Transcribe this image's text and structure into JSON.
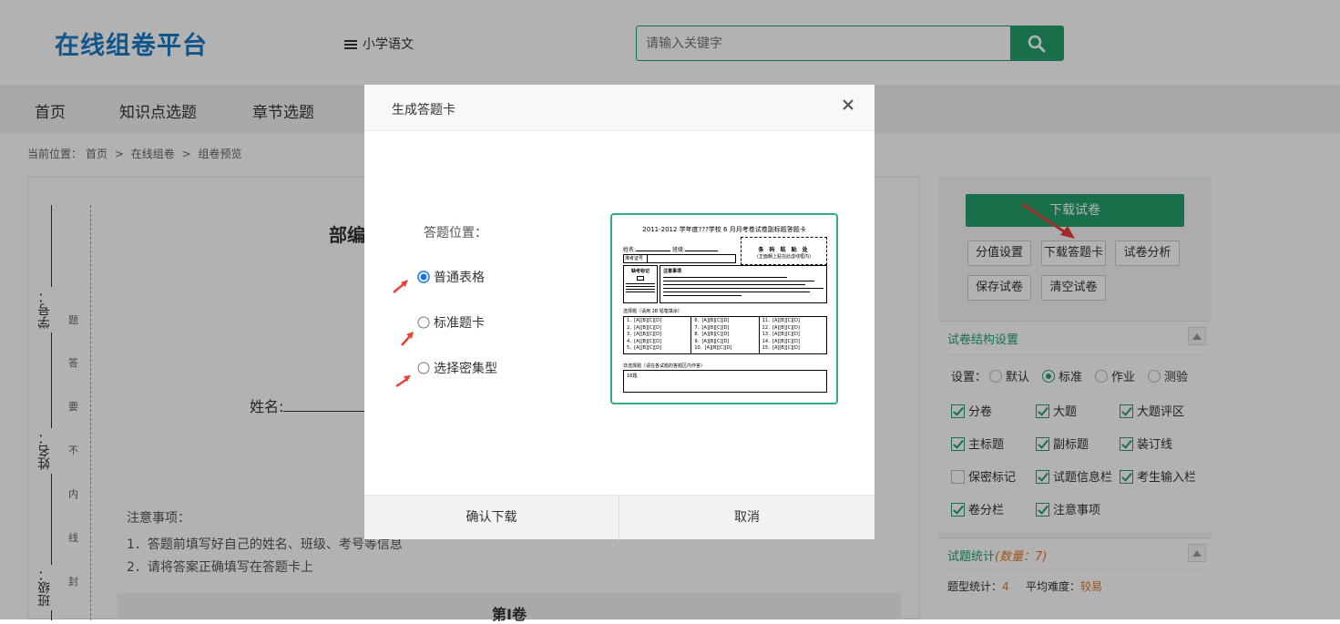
{
  "header": {
    "logo": "在线组卷平台",
    "subject": "小学语文",
    "search_placeholder": "请输入关键字"
  },
  "nav": {
    "items": [
      "首页",
      "知识点选题",
      "章节选题"
    ]
  },
  "breadcrumb": {
    "prefix": "当前位置：",
    "items": [
      "首页",
      "在线组卷",
      "组卷预览"
    ],
    "sep": ">"
  },
  "paper": {
    "title_partial": "部编",
    "name_label": "姓名:",
    "side_labels": [
      "学号：",
      "姓名：",
      "班级："
    ],
    "side_seal": [
      "题",
      "答",
      "要",
      "不",
      "内",
      "线",
      "封"
    ],
    "notice_title": "注意事项：",
    "notice_items": [
      "1．答题前填写好自己的姓名、班级、考号等信息",
      "2．请将答案正确填写在答题卡上"
    ],
    "section_partial": "第I卷"
  },
  "sidebar": {
    "download_label": "下载试卷",
    "buttons": [
      "分值设置",
      "下载答题卡",
      "试卷分析",
      "保存试卷",
      "清空试卷"
    ],
    "structure_title": "试卷结构设置",
    "settings_label": "设置：",
    "settings_options": [
      "默认",
      "标准",
      "作业",
      "测验"
    ],
    "settings_selected": "标准",
    "checkboxes": [
      {
        "label": "分卷",
        "checked": true
      },
      {
        "label": "大题",
        "checked": true
      },
      {
        "label": "大题评区",
        "checked": true
      },
      {
        "label": "主标题",
        "checked": true
      },
      {
        "label": "副标题",
        "checked": true
      },
      {
        "label": "装订线",
        "checked": true
      },
      {
        "label": "保密标记",
        "checked": false
      },
      {
        "label": "试题信息栏",
        "checked": true
      },
      {
        "label": "考生输入栏",
        "checked": true
      },
      {
        "label": "卷分栏",
        "checked": true
      },
      {
        "label": "注意事项",
        "checked": true
      }
    ],
    "stats_title": "试题统计",
    "stats_count": "(数量：7)",
    "type_stats_label": "题型统计：",
    "type_stats_value": "4",
    "difficulty_label": "平均难度：",
    "difficulty_value": "较易"
  },
  "modal": {
    "title": "生成答题卡",
    "position_label": "答题位置：",
    "options": [
      "普通表格",
      "标准题卡",
      "选择密集型"
    ],
    "selected": "普通表格",
    "confirm_label": "确认下载",
    "cancel_label": "取消"
  },
  "card_preview": {
    "title": "2011-2012 学年度???学校 6 月月考卷试卷副标题答题卡",
    "name_label": "姓名:",
    "class_label": "班级:",
    "exam_label": "准考证号",
    "barcode_line1": "条 码 粘 贴 处",
    "barcode_line2": "(正面朝上贴在此虚线框内)",
    "notice_label": "注意事项",
    "fill_label": "缺考标记",
    "mc_header": "选择题（请用 2B 铅笔填涂）",
    "mc_rows": [
      [
        "1．[A][B][C][D]",
        "6．[A][B][C][D]",
        "11．[A][B][C][D]"
      ],
      [
        "2．[A][B][C][D]",
        "7．[A][B][C][D]",
        "12．[A][B][C][D]"
      ],
      [
        "3．[A][B][C][D]",
        "8．[A][B][C][D]",
        "13．[A][B][C][D]"
      ],
      [
        "4．[A][B][C][D]",
        "9．[A][B][C][D]",
        "14．[A][B][C][D]"
      ],
      [
        "5．[A][B][C][D]",
        "10．[A][B][C][D]",
        "15．[A][B][C][D]"
      ]
    ],
    "free_header": "非选择题（请在各试题的答题区内作答）",
    "free_item": "16题."
  },
  "colors": {
    "brand_green": "#25a06a",
    "logo_blue": "#1a7bc4",
    "arrow_red": "#e8413a",
    "stat_orange": "#e8741c"
  }
}
